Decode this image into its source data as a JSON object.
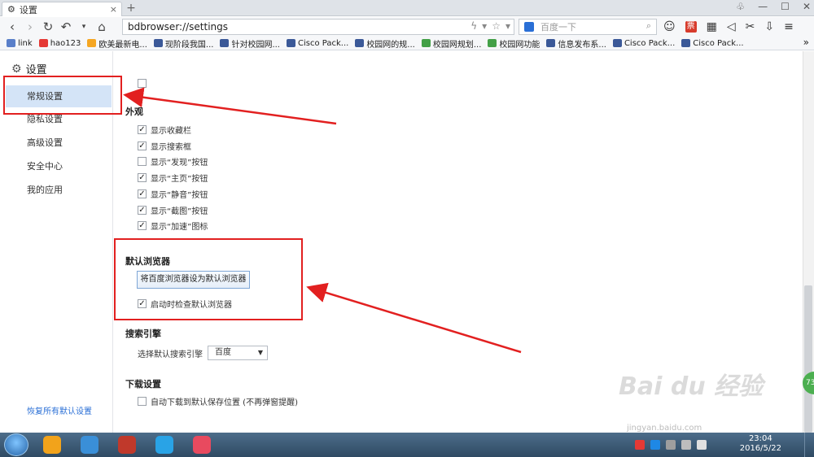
{
  "tab": {
    "title": "设置"
  },
  "address": {
    "url": "bdbrowser://settings"
  },
  "search": {
    "placeholder": "百度一下"
  },
  "toolbar_tools": [
    {
      "icon": "smiley-icon",
      "glyph": "☺"
    },
    {
      "icon": "red-badge-icon",
      "glyph": "票"
    },
    {
      "icon": "apps-grid-icon",
      "glyph": "▦"
    },
    {
      "icon": "speaker-icon",
      "glyph": "◁"
    },
    {
      "icon": "scissors-icon",
      "glyph": "✂"
    },
    {
      "icon": "download-icon",
      "glyph": "⇩"
    },
    {
      "icon": "menu-icon",
      "glyph": "≡"
    }
  ],
  "bookmarks": [
    {
      "label": "link",
      "color": "#5a7fc9"
    },
    {
      "label": "hao123",
      "color": "#e53935"
    },
    {
      "label": "欧美最新电...",
      "color": "#f5a623"
    },
    {
      "label": "现阶段我国...",
      "color": "#3b5998"
    },
    {
      "label": "针对校园网...",
      "color": "#3b5998"
    },
    {
      "label": "Cisco Pack...",
      "color": "#3b5998"
    },
    {
      "label": "校园网的规...",
      "color": "#3b5998"
    },
    {
      "label": "校园网规划...",
      "color": "#43a047"
    },
    {
      "label": "校园网功能",
      "color": "#43a047"
    },
    {
      "label": "信息发布系...",
      "color": "#3b5998"
    },
    {
      "label": "Cisco Pack...",
      "color": "#3b5998"
    },
    {
      "label": "Cisco Pack...",
      "color": "#3b5998"
    }
  ],
  "page": {
    "title": "设置"
  },
  "sidebar": {
    "items": [
      {
        "label": "常规设置",
        "active": true
      },
      {
        "label": "隐私设置"
      },
      {
        "label": "高级设置"
      },
      {
        "label": "安全中心"
      },
      {
        "label": "我的应用"
      }
    ],
    "restore": "恢复所有默认设置"
  },
  "appearance": {
    "heading": "外观",
    "options": [
      {
        "label": "显示收藏栏",
        "checked": true
      },
      {
        "label": "显示搜索框",
        "checked": true
      },
      {
        "label": "显示“发现”按钮",
        "checked": false
      },
      {
        "label": "显示“主页”按钮",
        "checked": true
      },
      {
        "label": "显示“静音”按钮",
        "checked": true
      },
      {
        "label": "显示“截图”按钮",
        "checked": true
      },
      {
        "label": "显示“加速”图标",
        "checked": true
      }
    ]
  },
  "default_browser": {
    "heading": "默认浏览器",
    "button": "将百度浏览器设为默认浏览器",
    "check_on_start": "启动时检查默认浏览器"
  },
  "search_engine": {
    "heading": "搜索引擎",
    "label": "选择默认搜索引擎",
    "value": "百度"
  },
  "download": {
    "heading": "下载设置",
    "option": "自动下载到默认保存位置 (不再弹窗提醒)"
  },
  "float_badge": "73",
  "watermark": {
    "text": "Bai du 经验",
    "sub": "jingyan.baidu.com"
  },
  "taskbar": {
    "time": "23:04",
    "date": "2016/5/22",
    "apps": [
      "#f2a31b",
      "#3a8fd8",
      "#c0392b",
      "#29a3e6",
      "#e84a5f"
    ]
  },
  "colors": {
    "annotation": "#e22020",
    "active_nav": "#d4e4f7"
  }
}
